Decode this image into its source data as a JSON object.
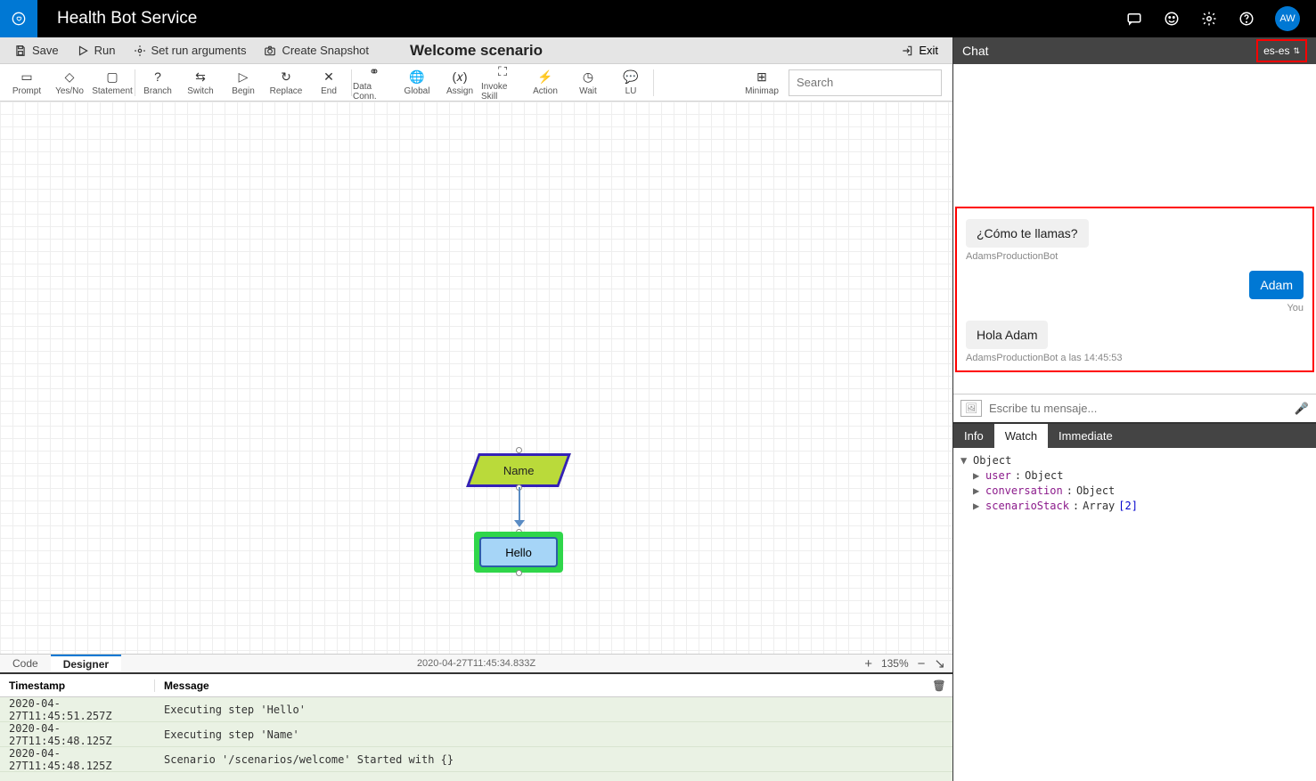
{
  "app": {
    "title": "Health Bot Service",
    "avatar": "AW"
  },
  "toolbar1": {
    "save": "Save",
    "run": "Run",
    "setArgs": "Set run arguments",
    "snapshot": "Create Snapshot",
    "scenarioTitle": "Welcome scenario",
    "exit": "Exit"
  },
  "palette": {
    "items": [
      "Prompt",
      "Yes/No",
      "Statement",
      "Branch",
      "Switch",
      "Begin",
      "Replace",
      "End",
      "Data Conn.",
      "Global",
      "Assign",
      "Invoke Skill",
      "Action",
      "Wait",
      "LU"
    ],
    "minimap": "Minimap",
    "searchPlaceholder": "Search"
  },
  "nodes": {
    "name": "Name",
    "hello": "Hello"
  },
  "tabs": {
    "code": "Code",
    "designer": "Designer",
    "timestamp": "2020-04-27T11:45:34.833Z",
    "zoom": "135%"
  },
  "log": {
    "headers": {
      "ts": "Timestamp",
      "msg": "Message"
    },
    "rows": [
      {
        "ts": "2020-04-27T11:45:51.257Z",
        "msg": "Executing step 'Hello'"
      },
      {
        "ts": "2020-04-27T11:45:48.125Z",
        "msg": "Executing step 'Name'"
      },
      {
        "ts": "2020-04-27T11:45:48.125Z",
        "msg": "Scenario '/scenarios/welcome' Started with {}"
      }
    ]
  },
  "chat": {
    "title": "Chat",
    "locale": "es-es",
    "botQuestion": "¿Cómo te llamas?",
    "botName": "AdamsProductionBot",
    "userReply": "Adam",
    "userLabel": "You",
    "botGreeting": "Hola Adam",
    "botGreetingMeta": "AdamsProductionBot a las 14:45:53",
    "inputPlaceholder": "Escribe tu mensaje..."
  },
  "debug": {
    "tabs": {
      "info": "Info",
      "watch": "Watch",
      "immediate": "Immediate"
    },
    "rootLabel": "Object",
    "userKey": "user",
    "userVal": "Object",
    "convKey": "conversation",
    "convVal": "Object",
    "stackKey": "scenarioStack",
    "stackVal": "Array ",
    "stackNum": "[2]"
  }
}
